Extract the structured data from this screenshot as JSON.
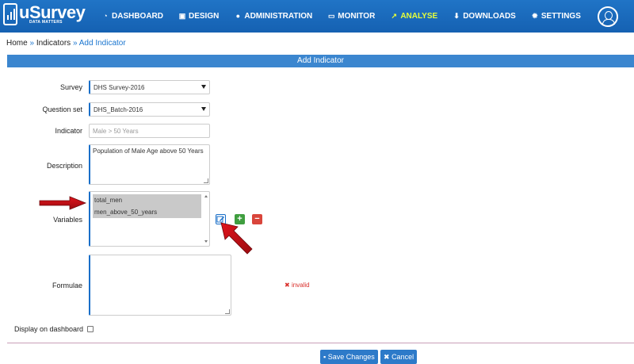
{
  "app": {
    "logo_text": "uSurvey",
    "logo_tagline": "DATA MATTERS"
  },
  "nav": [
    {
      "label": "DASHBOARD",
      "icon": "dashboard-icon",
      "active": false
    },
    {
      "label": "DESIGN",
      "icon": "design-icon",
      "active": false
    },
    {
      "label": "ADMINISTRATION",
      "icon": "user-icon",
      "active": false
    },
    {
      "label": "MONITOR",
      "icon": "monitor-icon",
      "active": false
    },
    {
      "label": "ANALYSE",
      "icon": "chart-icon",
      "active": true
    },
    {
      "label": "DOWNLOADS",
      "icon": "download-icon",
      "active": false
    },
    {
      "label": "SETTINGS",
      "icon": "gear-icon",
      "active": false
    }
  ],
  "breadcrumb": {
    "home": "Home",
    "indicators": "Indicators",
    "current": "Add Indicator",
    "separator": "»"
  },
  "page_title": "Add Indicator",
  "form": {
    "survey_label": "Survey",
    "survey_value": "DHS Survey-2016",
    "question_set_label": "Question set",
    "question_set_value": "DHS_Batch-2016",
    "indicator_label": "Indicator",
    "indicator_placeholder": "Male > 50 Years",
    "description_label": "Description",
    "description_value": "Population of Male Age above 50 Years",
    "variables_label": "Variables",
    "variables": [
      "total_men",
      "men_above_50_years"
    ],
    "formulae_label": "Formulae",
    "formulae_value": "",
    "validation_message": "invalid",
    "display_on_dashboard_label": "Display on dashboard"
  },
  "actions": {
    "save_label": "Save Changes",
    "cancel_label": "Cancel"
  },
  "colors": {
    "navbar": "#1c6cc0",
    "active_nav": "#e6ff3a",
    "title_bar": "#3b86cf",
    "error": "#d9302c"
  }
}
